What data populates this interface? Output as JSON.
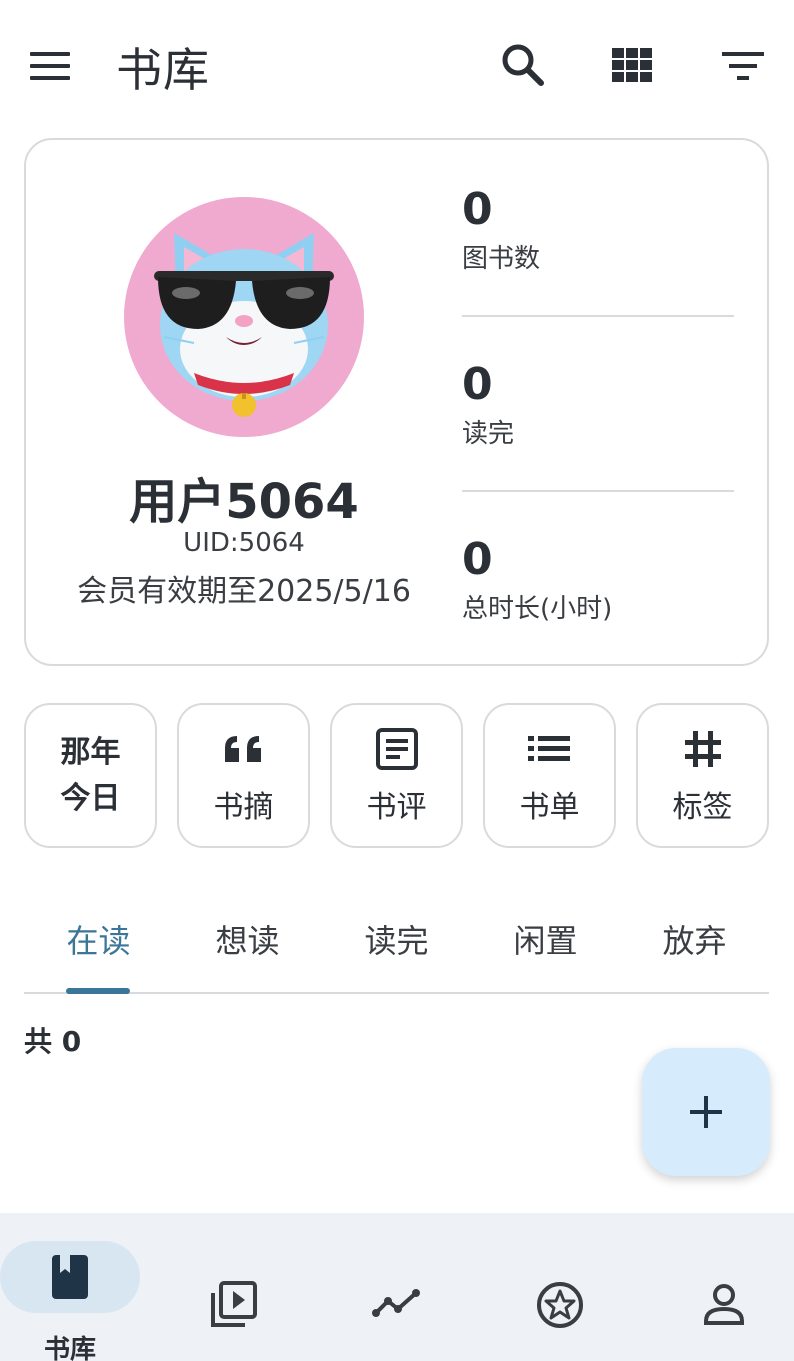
{
  "header": {
    "title": "书库",
    "icons": [
      "menu-icon",
      "search-icon",
      "grid-view-icon",
      "filter-icon"
    ]
  },
  "profile": {
    "username": "用户5064",
    "uid": "UID:5064",
    "membership": "会员有效期至2025/5/16",
    "avatar": "cat-with-sunglasses-avatar",
    "stats": [
      {
        "value": "0",
        "label": "图书数"
      },
      {
        "value": "0",
        "label": "读完"
      },
      {
        "value": "0",
        "label": "总时长(小时)"
      }
    ]
  },
  "shortcuts": {
    "memories": {
      "line1": "那年",
      "line2": "今日"
    },
    "items": [
      {
        "label": "书摘",
        "icon": "quote-icon"
      },
      {
        "label": "书评",
        "icon": "review-icon"
      },
      {
        "label": "书单",
        "icon": "list-icon"
      },
      {
        "label": "标签",
        "icon": "hashtag-icon"
      }
    ]
  },
  "tabs": {
    "items": [
      "在读",
      "想读",
      "读完",
      "闲置",
      "放弃"
    ],
    "active": "在读"
  },
  "list": {
    "count_label": "共 0"
  },
  "fab": {
    "icon": "plus-icon"
  },
  "bottom_nav": {
    "items": [
      {
        "label": "书库",
        "icon": "book-icon",
        "active": true
      },
      {
        "label": "",
        "icon": "video-library-icon"
      },
      {
        "label": "",
        "icon": "chart-line-icon"
      },
      {
        "label": "",
        "icon": "star-badge-icon"
      },
      {
        "label": "",
        "icon": "person-icon"
      }
    ]
  },
  "colors": {
    "accent": "#3b7597",
    "avatar_bg": "#f0a9cf",
    "fab_bg": "#d6ebfc",
    "nav_bg": "#eef1f5",
    "border": "#d8dadd"
  }
}
